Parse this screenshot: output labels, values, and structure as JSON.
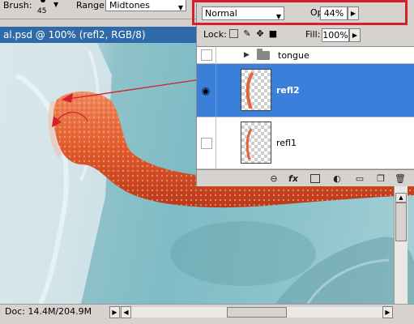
{
  "options_bar": {
    "brush_label": "Brush:",
    "brush_size": "45",
    "range_label": "Range:",
    "range_value": "Midtones"
  },
  "document": {
    "title": "al.psd @ 100% (refl2, RGB/8)"
  },
  "status_bar": {
    "doc_info": "Doc: 14.4M/204.9M"
  },
  "layers_panel": {
    "blend_mode": "Normal",
    "opacity_label": "Opacity:",
    "opacity_value": "44%",
    "lock_label": "Lock:",
    "fill_label": "Fill:",
    "fill_value": "100%",
    "layers": [
      {
        "name": "tongue",
        "type": "group",
        "visible": false,
        "selected": false
      },
      {
        "name": "refl2",
        "type": "layer",
        "visible": true,
        "selected": true
      },
      {
        "name": "refl1",
        "type": "layer",
        "visible": false,
        "selected": false
      }
    ],
    "footer_icons": [
      "link-icon",
      "fx-icon",
      "mask-icon",
      "adjustment-icon",
      "folder-icon",
      "new-layer-icon",
      "trash-icon"
    ]
  },
  "colors": {
    "selection": "#3a7fd9",
    "highlight": "#d4202b",
    "arrow": "#d4202b",
    "title_bar": "#2e6aa8"
  }
}
